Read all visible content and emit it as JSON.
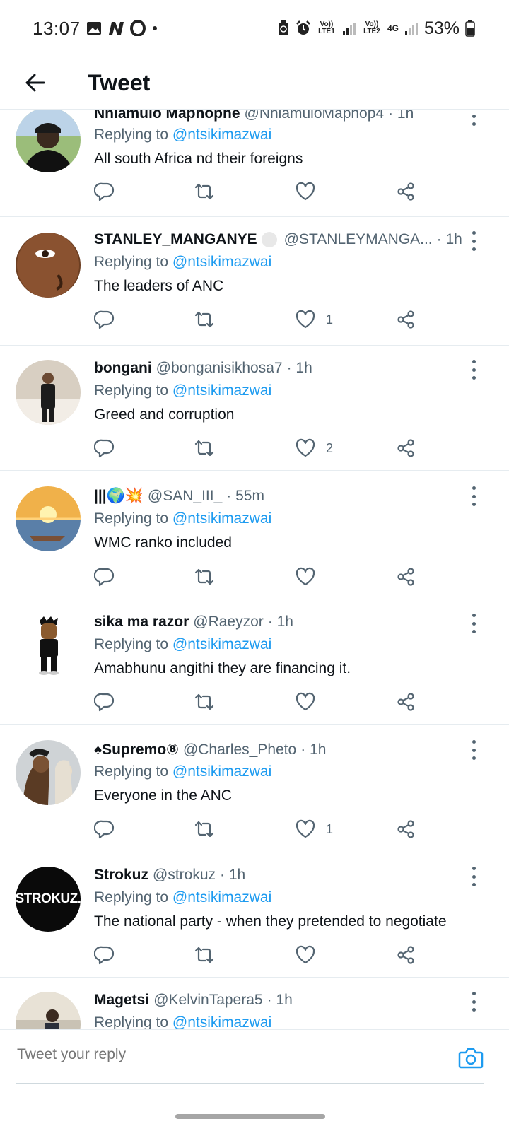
{
  "status_bar": {
    "time": "13:07",
    "lte1": "Vo)) LTE1",
    "lte2": "Vo)) LTE2",
    "net": "4G",
    "battery": "53%"
  },
  "header": {
    "title": "Tweet"
  },
  "tweets": [
    {
      "name": "Nhlamulo Maphophe",
      "handle": "@NhlamuloMaphop4",
      "time": "· 1h",
      "replying_prefix": "Replying to ",
      "replying_to": "@ntsikimazwai",
      "text": "All south Africa nd their foreigns",
      "likes": ""
    },
    {
      "name": "STANLEY_MANGANYE",
      "handle": "@STANLEYMANGA...",
      "time": "· 1h",
      "replying_prefix": "Replying to ",
      "replying_to": "@ntsikimazwai",
      "text": "The leaders of ANC",
      "likes": "1"
    },
    {
      "name": "bongani",
      "handle": "@bonganisikhosa7",
      "time": "· 1h",
      "replying_prefix": "Replying to ",
      "replying_to": "@ntsikimazwai",
      "text": "Greed and corruption",
      "likes": "2"
    },
    {
      "name": "|||🌍💥",
      "handle": "@SAN_III_",
      "time": "· 55m",
      "replying_prefix": "Replying to ",
      "replying_to": "@ntsikimazwai",
      "text": "WMC ranko included",
      "likes": ""
    },
    {
      "name": "sika ma razor",
      "handle": "@Raeyzor",
      "time": "· 1h",
      "replying_prefix": "Replying to ",
      "replying_to": "@ntsikimazwai",
      "text": "Amabhunu angithi they are financing it.",
      "likes": ""
    },
    {
      "name": "♠Supremo⑧",
      "handle": "@Charles_Pheto",
      "time": "· 1h",
      "replying_prefix": "Replying to ",
      "replying_to": "@ntsikimazwai",
      "text": "Everyone in the ANC",
      "likes": "1"
    },
    {
      "name": "Strokuz",
      "handle": "@strokuz",
      "time": "· 1h",
      "replying_prefix": "Replying to ",
      "replying_to": "@ntsikimazwai",
      "text": "The national party - when they pretended to negotiate",
      "likes": ""
    },
    {
      "name": "Magetsi",
      "handle": "@KelvinTapera5",
      "time": "· 1h",
      "replying_prefix": "Replying to ",
      "replying_to": "@ntsikimazwai",
      "text": "",
      "likes": ""
    }
  ],
  "avatar_labels": {
    "strokuz": "STROKUZ."
  },
  "reply_bar": {
    "placeholder": "Tweet your reply"
  },
  "colors": {
    "accent": "#1d9bf0",
    "text": "#0f1419",
    "secondary": "#536471"
  }
}
